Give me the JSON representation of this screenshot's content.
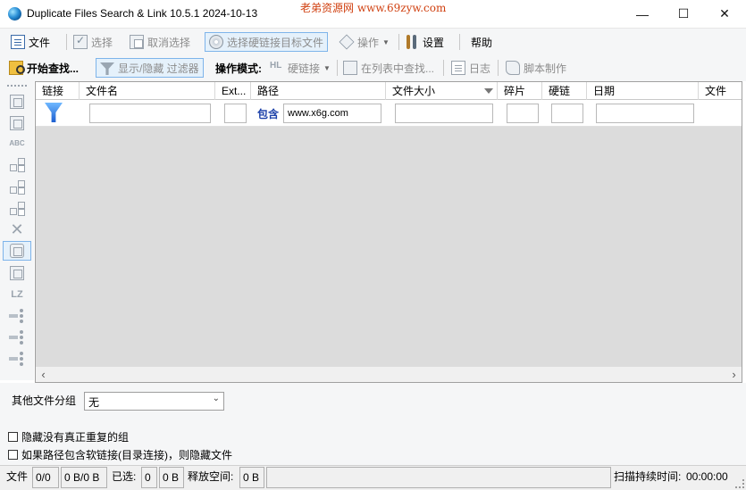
{
  "window": {
    "title": "Duplicate Files Search & Link 10.5.1 2024-10-13",
    "watermark": "老弟资源网 www.69zyw.com",
    "min_glyph": "—",
    "max_glyph": "☐",
    "close_glyph": "✕"
  },
  "toolbar1": {
    "file": "文件",
    "select": "选择",
    "deselect": "取消选择",
    "select_hardlink_target": "选择硬链接目标文件",
    "operations": "操作",
    "settings": "设置",
    "help": "帮助"
  },
  "toolbar2": {
    "start_search": "开始查找...",
    "toggle_filters": "显示/隐藏 过滤器",
    "mode_label": "操作模式:",
    "mode_hl_icon": "HL",
    "mode_value": "硬链接",
    "find_in_list": "在列表中查找...",
    "log": "日志",
    "script": "脚本制作"
  },
  "left_toolbar": {
    "abc_label": "ABC",
    "lz_label": "LZ"
  },
  "grid": {
    "columns": [
      "链接",
      "文件名",
      "Ext...",
      "路径",
      "文件大小",
      "碎片",
      "硬链",
      "日期",
      "文件"
    ],
    "filter_contains_label": "包含",
    "filter_path_value": "www.x6g.com"
  },
  "bottom": {
    "other_group_label": "其他文件分组",
    "other_group_value": "无",
    "hide_non_dup_groups": "隐藏没有真正重复的组",
    "hide_softlink_paths": "如果路径包含软链接(目录连接)，则隐藏文件"
  },
  "status": {
    "files_label": "文件",
    "files_count": "0/0",
    "files_size": "0 B/0 B",
    "selected_label": "已选:",
    "selected_count": "0",
    "selected_size": "0 B",
    "free_label": "释放空间:",
    "free_value": "0 B",
    "scan_duration_label": "扫描持续时间:",
    "scan_duration_value": "00:00:00"
  },
  "colors": {
    "accent_border": "#7eb4ea",
    "accent_fill": "#e5f1fb",
    "contains_label": "#1a3fa8",
    "watermark": "#d04010"
  }
}
